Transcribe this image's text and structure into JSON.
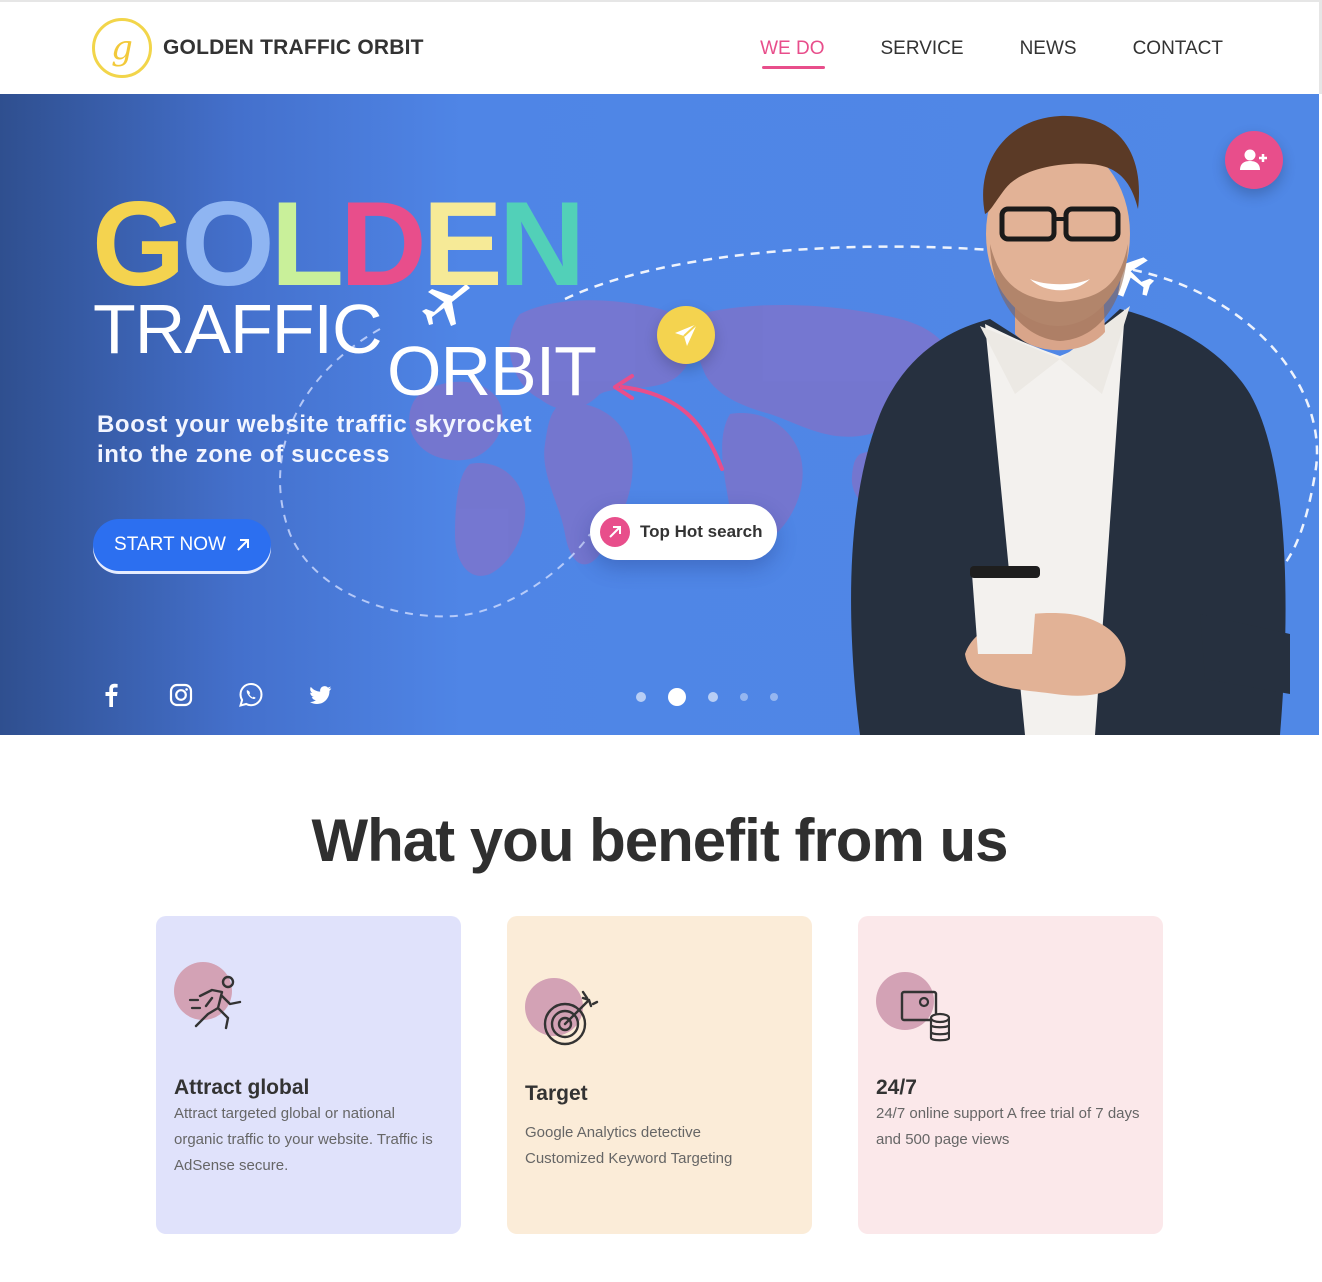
{
  "header": {
    "logo_mark": "g",
    "brand": "GOLDEN TRAFFIC ORBIT",
    "nav": [
      {
        "label": "WE DO",
        "active": true
      },
      {
        "label": "SERVICE",
        "active": false
      },
      {
        "label": "NEWS",
        "active": false
      },
      {
        "label": "CONTACT",
        "active": false
      }
    ]
  },
  "hero": {
    "golden_letters": [
      {
        "char": "G",
        "color": "#f4d34f"
      },
      {
        "char": "O",
        "color": "#8fb5f2"
      },
      {
        "char": "L",
        "color": "#c9f09a"
      },
      {
        "char": "D",
        "color": "#e84e8b"
      },
      {
        "char": "E",
        "color": "#f6ea97"
      },
      {
        "char": "N",
        "color": "#52d0b8"
      }
    ],
    "traffic": "TRAFFIC",
    "orbit": "ORBIT",
    "subtitle": "Boost your website traffic skyrocket into the zone of success",
    "cta_label": "START NOW",
    "cta_icon": "arrow-up-right-icon",
    "hot_search_label": "Top Hot search",
    "socials": [
      "facebook-icon",
      "instagram-icon",
      "whatsapp-icon",
      "twitter-icon"
    ],
    "slides": {
      "count": 5,
      "active": 2
    }
  },
  "benefits": {
    "title": "What you benefit from us",
    "cards": [
      {
        "title": "Attract global",
        "text": "Attract targeted global or national organic traffic to your website. Traffic is AdSense secure.",
        "icon": "runner-icon",
        "color": "#e0e2fb"
      },
      {
        "title": "Target",
        "text": "Google Analytics detective Customized Keyword Targeting",
        "icon": "target-icon",
        "color": "#fbecd8"
      },
      {
        "title": "24/7",
        "text": "24/7 online support A free trial of 7 days and 500 page views",
        "icon": "monitor-database-icon",
        "color": "#fbe8ea"
      }
    ]
  },
  "colors": {
    "accent": "#e84e8b",
    "hero_blue": "#5088e6",
    "cta_blue": "#2c6ff0",
    "yellow": "#f4d34f"
  }
}
